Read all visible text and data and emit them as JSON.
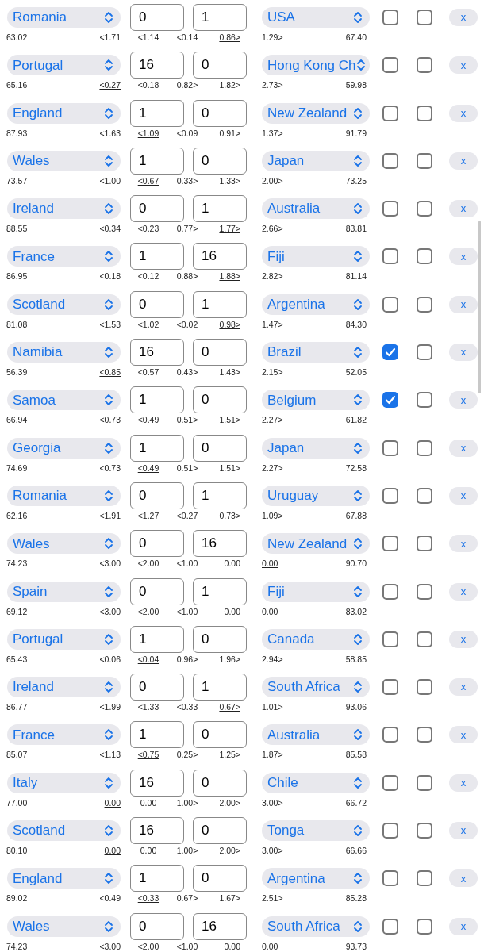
{
  "rows": [
    {
      "home": "Romania",
      "home_score": "0",
      "away_score": "1",
      "away": "USA",
      "check_a": false,
      "check_b": false,
      "remove": "x",
      "home_rating": "63.02",
      "away_rating": "67.40",
      "odds": [
        {
          "text": "<1.71",
          "underlined": false
        },
        {
          "text": "<1.14",
          "underlined": false
        },
        {
          "text": "<0.14",
          "underlined": false
        },
        {
          "text": "0.86>",
          "underlined": true
        },
        {
          "text": "1.29>",
          "underlined": false
        }
      ]
    },
    {
      "home": "Portugal",
      "home_score": "16",
      "away_score": "0",
      "away": "Hong Kong Ch",
      "check_a": false,
      "check_b": false,
      "remove": "x",
      "home_rating": "65.16",
      "away_rating": "59.98",
      "odds": [
        {
          "text": "<0.27",
          "underlined": true
        },
        {
          "text": "<0.18",
          "underlined": false
        },
        {
          "text": "0.82>",
          "underlined": false
        },
        {
          "text": "1.82>",
          "underlined": false
        },
        {
          "text": "2.73>",
          "underlined": false
        }
      ]
    },
    {
      "home": "England",
      "home_score": "1",
      "away_score": "0",
      "away": "New Zealand",
      "check_a": false,
      "check_b": false,
      "remove": "x",
      "home_rating": "87.93",
      "away_rating": "91.79",
      "odds": [
        {
          "text": "<1.63",
          "underlined": false
        },
        {
          "text": "<1.09",
          "underlined": true
        },
        {
          "text": "<0.09",
          "underlined": false
        },
        {
          "text": "0.91>",
          "underlined": false
        },
        {
          "text": "1.37>",
          "underlined": false
        }
      ]
    },
    {
      "home": "Wales",
      "home_score": "1",
      "away_score": "0",
      "away": "Japan",
      "check_a": false,
      "check_b": false,
      "remove": "x",
      "home_rating": "73.57",
      "away_rating": "73.25",
      "odds": [
        {
          "text": "<1.00",
          "underlined": false
        },
        {
          "text": "<0.67",
          "underlined": true
        },
        {
          "text": "0.33>",
          "underlined": false
        },
        {
          "text": "1.33>",
          "underlined": false
        },
        {
          "text": "2.00>",
          "underlined": false
        }
      ]
    },
    {
      "home": "Ireland",
      "home_score": "0",
      "away_score": "1",
      "away": "Australia",
      "check_a": false,
      "check_b": false,
      "remove": "x",
      "home_rating": "88.55",
      "away_rating": "83.81",
      "odds": [
        {
          "text": "<0.34",
          "underlined": false
        },
        {
          "text": "<0.23",
          "underlined": false
        },
        {
          "text": "0.77>",
          "underlined": false
        },
        {
          "text": "1.77>",
          "underlined": true
        },
        {
          "text": "2.66>",
          "underlined": false
        }
      ]
    },
    {
      "home": "France",
      "home_score": "1",
      "away_score": "16",
      "away": "Fiji",
      "check_a": false,
      "check_b": false,
      "remove": "x",
      "home_rating": "86.95",
      "away_rating": "81.14",
      "odds": [
        {
          "text": "<0.18",
          "underlined": false
        },
        {
          "text": "<0.12",
          "underlined": false
        },
        {
          "text": "0.88>",
          "underlined": false
        },
        {
          "text": "1.88>",
          "underlined": true
        },
        {
          "text": "2.82>",
          "underlined": false
        }
      ]
    },
    {
      "home": "Scotland",
      "home_score": "0",
      "away_score": "1",
      "away": "Argentina",
      "check_a": false,
      "check_b": false,
      "remove": "x",
      "home_rating": "81.08",
      "away_rating": "84.30",
      "odds": [
        {
          "text": "<1.53",
          "underlined": false
        },
        {
          "text": "<1.02",
          "underlined": false
        },
        {
          "text": "<0.02",
          "underlined": false
        },
        {
          "text": "0.98>",
          "underlined": true
        },
        {
          "text": "1.47>",
          "underlined": false
        }
      ]
    },
    {
      "home": "Namibia",
      "home_score": "16",
      "away_score": "0",
      "away": "Brazil",
      "check_a": true,
      "check_b": false,
      "remove": "x",
      "home_rating": "56.39",
      "away_rating": "52.05",
      "odds": [
        {
          "text": "<0.85",
          "underlined": true
        },
        {
          "text": "<0.57",
          "underlined": false
        },
        {
          "text": "0.43>",
          "underlined": false
        },
        {
          "text": "1.43>",
          "underlined": false
        },
        {
          "text": "2.15>",
          "underlined": false
        }
      ]
    },
    {
      "home": "Samoa",
      "home_score": "1",
      "away_score": "0",
      "away": "Belgium",
      "check_a": true,
      "check_b": false,
      "remove": "x",
      "home_rating": "66.94",
      "away_rating": "61.82",
      "odds": [
        {
          "text": "<0.73",
          "underlined": false
        },
        {
          "text": "<0.49",
          "underlined": true
        },
        {
          "text": "0.51>",
          "underlined": false
        },
        {
          "text": "1.51>",
          "underlined": false
        },
        {
          "text": "2.27>",
          "underlined": false
        }
      ]
    },
    {
      "home": "Georgia",
      "home_score": "1",
      "away_score": "0",
      "away": "Japan",
      "check_a": false,
      "check_b": false,
      "remove": "x",
      "home_rating": "74.69",
      "away_rating": "72.58",
      "odds": [
        {
          "text": "<0.73",
          "underlined": false
        },
        {
          "text": "<0.49",
          "underlined": true
        },
        {
          "text": "0.51>",
          "underlined": false
        },
        {
          "text": "1.51>",
          "underlined": false
        },
        {
          "text": "2.27>",
          "underlined": false
        }
      ]
    },
    {
      "home": "Romania",
      "home_score": "0",
      "away_score": "1",
      "away": "Uruguay",
      "check_a": false,
      "check_b": false,
      "remove": "x",
      "home_rating": "62.16",
      "away_rating": "67.88",
      "odds": [
        {
          "text": "<1.91",
          "underlined": false
        },
        {
          "text": "<1.27",
          "underlined": false
        },
        {
          "text": "<0.27",
          "underlined": false
        },
        {
          "text": "0.73>",
          "underlined": true
        },
        {
          "text": "1.09>",
          "underlined": false
        }
      ]
    },
    {
      "home": "Wales",
      "home_score": "0",
      "away_score": "16",
      "away": "New Zealand",
      "check_a": false,
      "check_b": false,
      "remove": "x",
      "home_rating": "74.23",
      "away_rating": "90.70",
      "odds": [
        {
          "text": "<3.00",
          "underlined": false
        },
        {
          "text": "<2.00",
          "underlined": false
        },
        {
          "text": "<1.00",
          "underlined": false
        },
        {
          "text": "0.00",
          "underlined": false
        },
        {
          "text": "0.00",
          "underlined": true
        }
      ]
    },
    {
      "home": "Spain",
      "home_score": "0",
      "away_score": "1",
      "away": "Fiji",
      "check_a": false,
      "check_b": false,
      "remove": "x",
      "home_rating": "69.12",
      "away_rating": "83.02",
      "odds": [
        {
          "text": "<3.00",
          "underlined": false
        },
        {
          "text": "<2.00",
          "underlined": false
        },
        {
          "text": "<1.00",
          "underlined": false
        },
        {
          "text": "0.00",
          "underlined": true
        },
        {
          "text": "0.00",
          "underlined": false
        }
      ]
    },
    {
      "home": "Portugal",
      "home_score": "1",
      "away_score": "0",
      "away": "Canada",
      "check_a": false,
      "check_b": false,
      "remove": "x",
      "home_rating": "65.43",
      "away_rating": "58.85",
      "odds": [
        {
          "text": "<0.06",
          "underlined": false
        },
        {
          "text": "<0.04",
          "underlined": true
        },
        {
          "text": "0.96>",
          "underlined": false
        },
        {
          "text": "1.96>",
          "underlined": false
        },
        {
          "text": "2.94>",
          "underlined": false
        }
      ]
    },
    {
      "home": "Ireland",
      "home_score": "0",
      "away_score": "1",
      "away": "South Africa",
      "check_a": false,
      "check_b": false,
      "remove": "x",
      "home_rating": "86.77",
      "away_rating": "93.06",
      "odds": [
        {
          "text": "<1.99",
          "underlined": false
        },
        {
          "text": "<1.33",
          "underlined": false
        },
        {
          "text": "<0.33",
          "underlined": false
        },
        {
          "text": "0.67>",
          "underlined": true
        },
        {
          "text": "1.01>",
          "underlined": false
        }
      ]
    },
    {
      "home": "France",
      "home_score": "1",
      "away_score": "0",
      "away": "Australia",
      "check_a": false,
      "check_b": false,
      "remove": "x",
      "home_rating": "85.07",
      "away_rating": "85.58",
      "odds": [
        {
          "text": "<1.13",
          "underlined": false
        },
        {
          "text": "<0.75",
          "underlined": true
        },
        {
          "text": "0.25>",
          "underlined": false
        },
        {
          "text": "1.25>",
          "underlined": false
        },
        {
          "text": "1.87>",
          "underlined": false
        }
      ]
    },
    {
      "home": "Italy",
      "home_score": "16",
      "away_score": "0",
      "away": "Chile",
      "check_a": false,
      "check_b": false,
      "remove": "x",
      "home_rating": "77.00",
      "away_rating": "66.72",
      "odds": [
        {
          "text": "0.00",
          "underlined": true
        },
        {
          "text": "0.00",
          "underlined": false
        },
        {
          "text": "1.00>",
          "underlined": false
        },
        {
          "text": "2.00>",
          "underlined": false
        },
        {
          "text": "3.00>",
          "underlined": false
        }
      ]
    },
    {
      "home": "Scotland",
      "home_score": "16",
      "away_score": "0",
      "away": "Tonga",
      "check_a": false,
      "check_b": false,
      "remove": "x",
      "home_rating": "80.10",
      "away_rating": "66.66",
      "odds": [
        {
          "text": "0.00",
          "underlined": true
        },
        {
          "text": "0.00",
          "underlined": false
        },
        {
          "text": "1.00>",
          "underlined": false
        },
        {
          "text": "2.00>",
          "underlined": false
        },
        {
          "text": "3.00>",
          "underlined": false
        }
      ]
    },
    {
      "home": "England",
      "home_score": "1",
      "away_score": "0",
      "away": "Argentina",
      "check_a": false,
      "check_b": false,
      "remove": "x",
      "home_rating": "89.02",
      "away_rating": "85.28",
      "odds": [
        {
          "text": "<0.49",
          "underlined": false
        },
        {
          "text": "<0.33",
          "underlined": true
        },
        {
          "text": "0.67>",
          "underlined": false
        },
        {
          "text": "1.67>",
          "underlined": false
        },
        {
          "text": "2.51>",
          "underlined": false
        }
      ]
    },
    {
      "home": "Wales",
      "home_score": "0",
      "away_score": "16",
      "away": "South Africa",
      "check_a": false,
      "check_b": false,
      "remove": "x",
      "home_rating": "74.23",
      "away_rating": "93.73",
      "odds": [
        {
          "text": "<3.00",
          "underlined": false
        },
        {
          "text": "<2.00",
          "underlined": false
        },
        {
          "text": "<1.00",
          "underlined": false
        },
        {
          "text": "0.00",
          "underlined": false
        },
        {
          "text": "0.00",
          "underlined": false
        }
      ]
    }
  ]
}
